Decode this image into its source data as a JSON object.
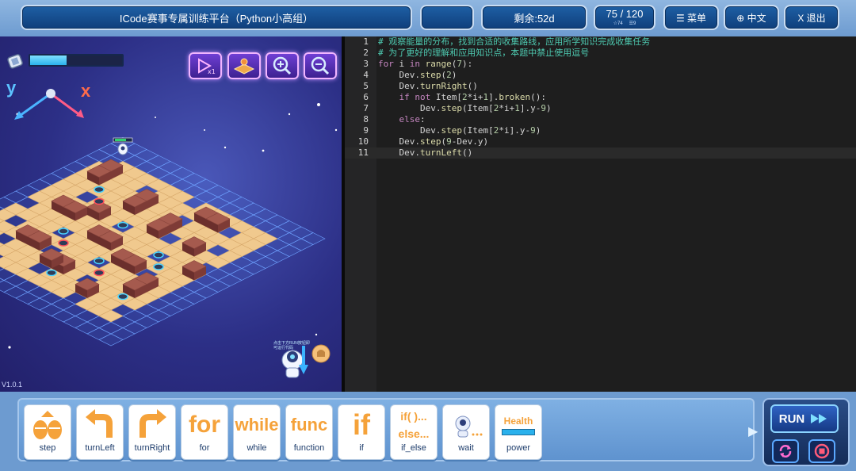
{
  "topbar": {
    "title": "ICode赛事专属训练平台（Python小高组）",
    "remaining": "剩余:52d",
    "progress": "75 / 120",
    "progress_sub1": "☆74",
    "progress_sub2": "☰9",
    "menu_label": "☰ 菜单",
    "lang_label": "⊕ 中文",
    "exit_label": "X 退出"
  },
  "game": {
    "version": "V1.0.1",
    "axis_x": "x",
    "axis_y": "y",
    "energy_level": 0.4,
    "helper_text": "点击下方RUN按钮即可运行代码",
    "buttons": [
      "speed-icon",
      "map-icon",
      "zoom-in-icon",
      "zoom-out-icon"
    ]
  },
  "editor": {
    "lines": [
      {
        "n": "1"
      },
      {
        "n": "2"
      },
      {
        "n": "3"
      },
      {
        "n": "4"
      },
      {
        "n": "5"
      },
      {
        "n": "6"
      },
      {
        "n": "7"
      },
      {
        "n": "8"
      },
      {
        "n": "9"
      },
      {
        "n": "10"
      },
      {
        "n": "11"
      }
    ],
    "code": {
      "l1": "# 观察能量的分布，找到合适的收集路线，应用所学知识完成收集任务",
      "l2": "# 为了更好的理解和应用知识点，本题中禁止使用逗号",
      "l3_kw1": "for",
      "l3_a": " i ",
      "l3_kw2": "in",
      "l3_fn": " range",
      "l3_p1": "(",
      "l3_n": "7",
      "l3_p2": "):",
      "l4_a": "    Dev.",
      "l4_fn": "step",
      "l4_p1": "(",
      "l4_n": "2",
      "l4_p2": ")",
      "l5_a": "    Dev.",
      "l5_fn": "turnRight",
      "l5_p": "()",
      "l6_kw": "    if not",
      "l6_a": " Item[",
      "l6_n1": "2",
      "l6_b": "*i+",
      "l6_n2": "1",
      "l6_c": "].",
      "l6_fn": "broken",
      "l6_d": "():",
      "l7_a": "        Dev.",
      "l7_fn": "step",
      "l7_b": "(Item[",
      "l7_n1": "2",
      "l7_c": "*i+",
      "l7_n2": "1",
      "l7_d": "].y-",
      "l7_n3": "9",
      "l7_e": ")",
      "l8_kw": "    else",
      "l8_a": ":",
      "l9_a": "        Dev.",
      "l9_fn": "step",
      "l9_b": "(Item[",
      "l9_n1": "2",
      "l9_c": "*i].y-",
      "l9_n2": "9",
      "l9_d": ")",
      "l10_a": "    Dev.",
      "l10_fn": "step",
      "l10_b": "(",
      "l10_n": "9",
      "l10_c": "-Dev.y)",
      "l11_a": "    Dev.",
      "l11_fn": "turnLeft",
      "l11_b": "()"
    }
  },
  "blocks": [
    {
      "label": "step",
      "icon": "step"
    },
    {
      "label": "turnLeft",
      "icon": "turnLeft"
    },
    {
      "label": "turnRight",
      "icon": "turnRight"
    },
    {
      "label": "for",
      "icon": "for"
    },
    {
      "label": "while",
      "icon": "while"
    },
    {
      "label": "function",
      "icon": "func"
    },
    {
      "label": "if",
      "icon": "if"
    },
    {
      "label": "if_else",
      "icon": "if()...else..."
    },
    {
      "label": "wait",
      "icon": "wait"
    },
    {
      "label": "power",
      "icon": "Health"
    }
  ],
  "run": {
    "label": "RUN"
  },
  "colors": {
    "accent": "#f5a23a",
    "editor_bg": "#1e1e1e",
    "comment": "#4ec9b0",
    "keyword": "#c586c0"
  }
}
